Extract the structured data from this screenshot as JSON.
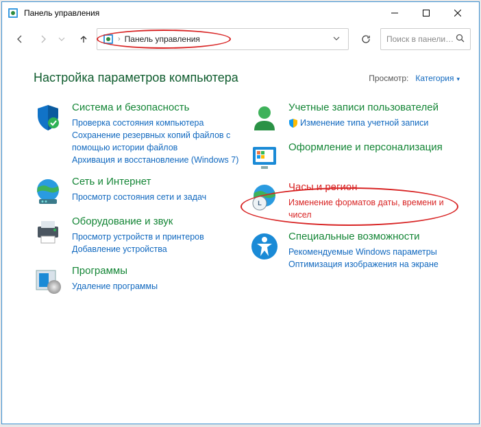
{
  "window": {
    "title": "Панель управления"
  },
  "address": {
    "text": "Панель управления"
  },
  "search": {
    "placeholder": "Поиск в панели у..."
  },
  "heading": "Настройка параметров компьютера",
  "view": {
    "label": "Просмотр:",
    "value": "Категория"
  },
  "cats": {
    "security": {
      "title": "Система и безопасность",
      "l1": "Проверка состояния компьютера",
      "l2": "Сохранение резервных копий файлов с помощью истории файлов",
      "l3": "Архивация и восстановление (Windows 7)"
    },
    "network": {
      "title": "Сеть и Интернет",
      "l1": "Просмотр состояния сети и задач"
    },
    "hardware": {
      "title": "Оборудование и звук",
      "l1": "Просмотр устройств и принтеров",
      "l2": "Добавление устройства"
    },
    "programs": {
      "title": "Программы",
      "l1": "Удаление программы"
    },
    "users": {
      "title": "Учетные записи пользователей",
      "l1": "Изменение типа учетной записи"
    },
    "appearance": {
      "title": "Оформление и персонализация"
    },
    "clock": {
      "title": "Часы и регион",
      "l1": "Изменение форматов даты, времени и чисел"
    },
    "ease": {
      "title": "Специальные возможности",
      "l1": "Рекомендуемые Windows параметры",
      "l2": "Оптимизация изображения на экране"
    }
  }
}
